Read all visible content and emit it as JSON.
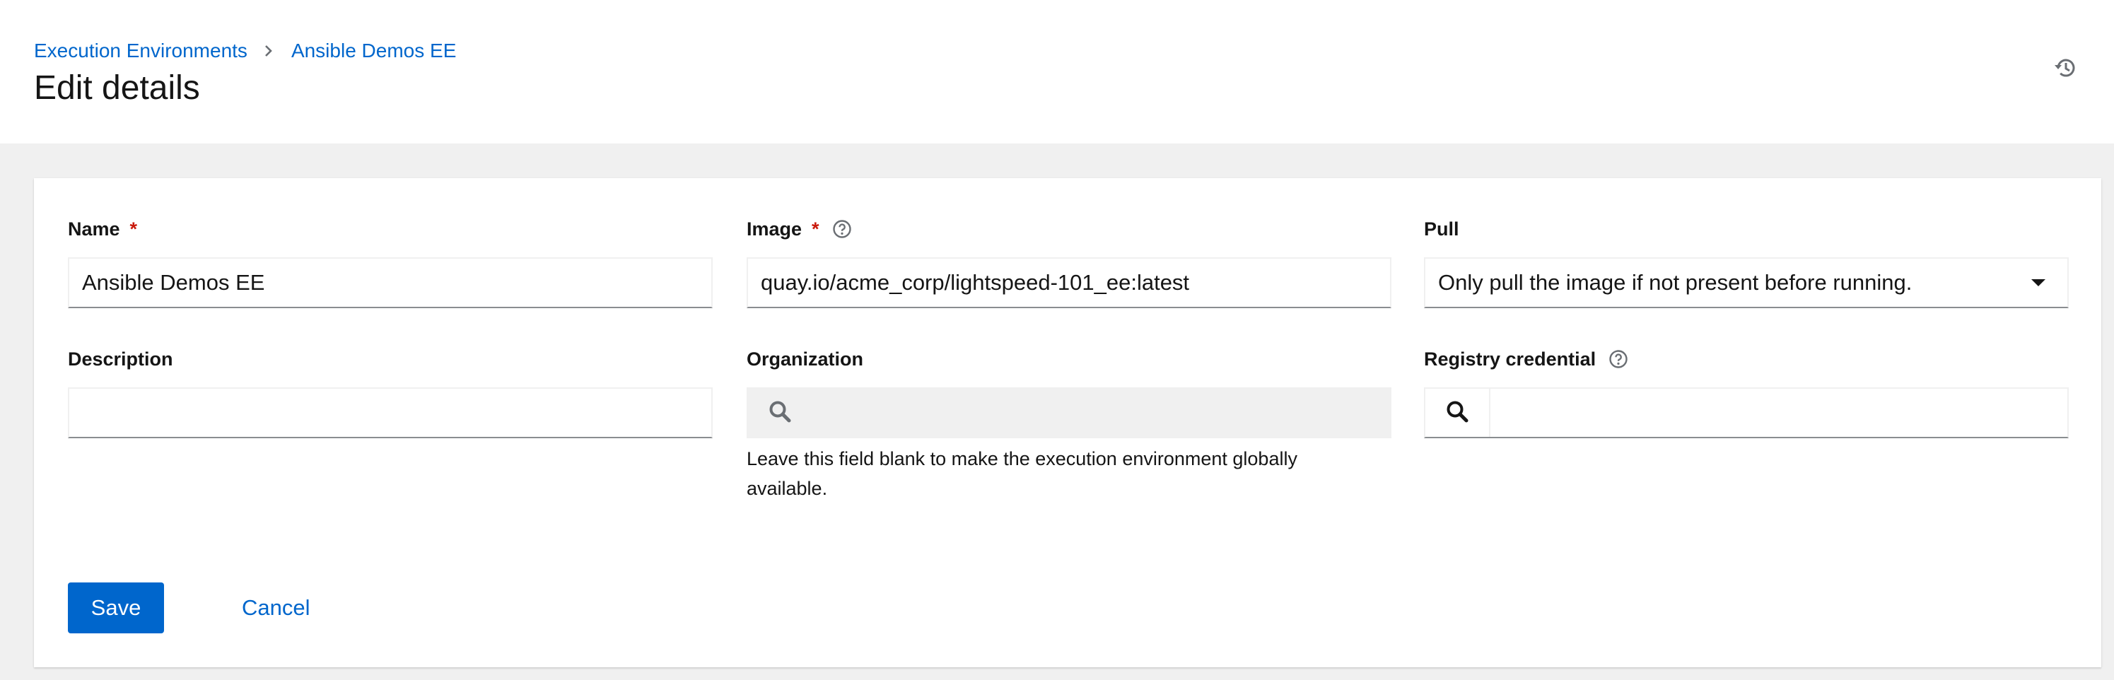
{
  "breadcrumb": {
    "items": [
      "Execution Environments",
      "Ansible Demos EE"
    ]
  },
  "header": {
    "title": "Edit details",
    "history_icon": "history-icon"
  },
  "form": {
    "name": {
      "label": "Name",
      "required_mark": "*",
      "value": "Ansible Demos EE"
    },
    "image": {
      "label": "Image",
      "required_mark": "*",
      "value": "quay.io/acme_corp/lightspeed-101_ee:latest",
      "help_icon": "question-circle-icon"
    },
    "pull": {
      "label": "Pull",
      "selected": "Only pull the image if not present before running."
    },
    "description": {
      "label": "Description",
      "value": ""
    },
    "organization": {
      "label": "Organization",
      "helper": "Leave this field blank to make the execution environment globally available.",
      "icon": "search-icon"
    },
    "registry_credential": {
      "label": "Registry credential",
      "help_icon": "question-circle-icon",
      "icon": "search-icon",
      "value": ""
    }
  },
  "actions": {
    "save_label": "Save",
    "cancel_label": "Cancel"
  },
  "colors": {
    "link": "#0066cc",
    "primary": "#0066cc",
    "required": "#c9190b",
    "background": "#f0f0f0"
  }
}
